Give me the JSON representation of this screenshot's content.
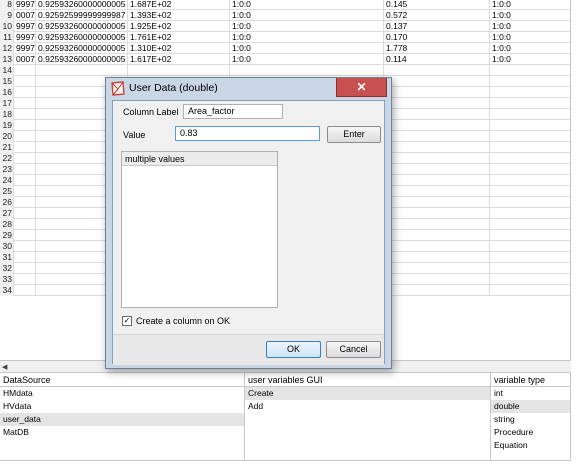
{
  "grid": {
    "rows": [
      {
        "num": "8",
        "c1": "9997",
        "c2": "0.92593260000000005",
        "c3": "1.687E+02",
        "c4": "1:0:0",
        "c5": "0.145",
        "c6": "1:0:0"
      },
      {
        "num": "9",
        "c1": "0007",
        "c2": "0.92592599999999987",
        "c3": "1.393E+02",
        "c4": "1:0:0",
        "c5": "0.572",
        "c6": "1:0:0"
      },
      {
        "num": "10",
        "c1": "9997",
        "c2": "0.92593260000000005",
        "c3": "1.925E+02",
        "c4": "1:0:0",
        "c5": "0.137",
        "c6": "1:0:0"
      },
      {
        "num": "11",
        "c1": "9997",
        "c2": "0.92593260000000005",
        "c3": "1.761E+02",
        "c4": "1:0:0",
        "c5": "0.170",
        "c6": "1:0:0"
      },
      {
        "num": "12",
        "c1": "9997",
        "c2": "0.92593260000000005",
        "c3": "1.310E+02",
        "c4": "1:0:0",
        "c5": "1.778",
        "c6": "1:0:0"
      },
      {
        "num": "13",
        "c1": "0007",
        "c2": "0.92593260000000005",
        "c3": "1.617E+02",
        "c4": "1:0:0",
        "c5": "0.114",
        "c6": "1:0:0"
      },
      {
        "num": "14"
      },
      {
        "num": "15"
      },
      {
        "num": "16"
      },
      {
        "num": "17"
      },
      {
        "num": "18"
      },
      {
        "num": "19"
      },
      {
        "num": "20"
      },
      {
        "num": "21"
      },
      {
        "num": "22"
      },
      {
        "num": "23"
      },
      {
        "num": "24"
      },
      {
        "num": "25"
      },
      {
        "num": "26"
      },
      {
        "num": "27"
      },
      {
        "num": "28"
      },
      {
        "num": "29"
      },
      {
        "num": "30"
      },
      {
        "num": "31"
      },
      {
        "num": "32"
      },
      {
        "num": "33"
      },
      {
        "num": "34"
      }
    ]
  },
  "panels": {
    "datasource": {
      "header": "DataSource",
      "items": [
        "HMdata",
        "HVdata",
        "user_data",
        "MatDB"
      ],
      "selected": 2
    },
    "gui": {
      "header": "user variables GUI",
      "items": [
        "Create",
        "Add"
      ],
      "selected": 0
    },
    "vartype": {
      "header": "variable type",
      "items": [
        "int",
        "double",
        "string",
        "Procedure",
        "Equation"
      ],
      "selected": 1
    }
  },
  "dialog": {
    "title": "User Data (double)",
    "close_glyph": "✕",
    "column_label_lbl": "Column Label",
    "column_label_value": "Area_factor",
    "value_lbl": "Value",
    "value_value": "0.83",
    "enter_label": "Enter",
    "multiple_values_header": "multiple values",
    "create_column_checked_glyph": "✓",
    "create_column_label": "Create a column on OK",
    "ok_label": "OK",
    "cancel_label": "Cancel"
  },
  "colors": {
    "dialog_frame": "#c9d6e6",
    "close_button": "#c75050",
    "selection": "#e4e4e4",
    "focus_border": "#5b9bd5"
  },
  "icons": {
    "app": "app-logo-icon",
    "scroll_left": "arrow-left-icon"
  }
}
